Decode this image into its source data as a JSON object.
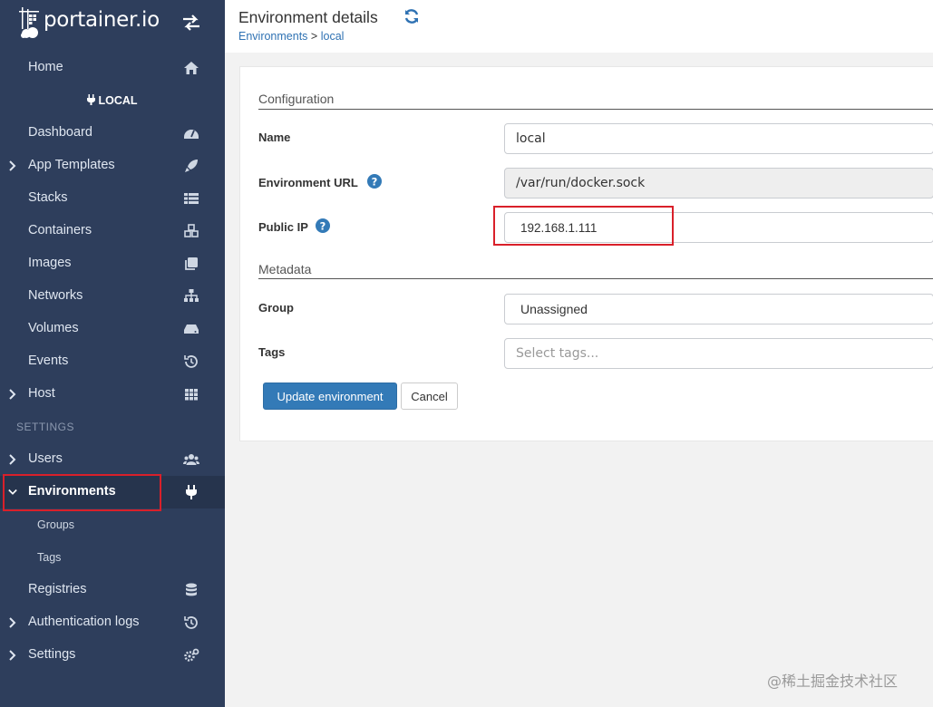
{
  "brand": {
    "name": "portainer.io"
  },
  "sidebar": {
    "home": "Home",
    "environment_badge": "LOCAL",
    "items": [
      {
        "label": "Dashboard",
        "icon": "dashboard-icon"
      },
      {
        "label": "App Templates",
        "icon": "rocket-icon",
        "expandable": true
      },
      {
        "label": "Stacks",
        "icon": "th-list-icon"
      },
      {
        "label": "Containers",
        "icon": "cubes-icon"
      },
      {
        "label": "Images",
        "icon": "clone-icon"
      },
      {
        "label": "Networks",
        "icon": "sitemap-icon"
      },
      {
        "label": "Volumes",
        "icon": "hdd-icon"
      },
      {
        "label": "Events",
        "icon": "history-icon"
      },
      {
        "label": "Host",
        "icon": "th-icon",
        "expandable": true
      }
    ],
    "settings_section": "SETTINGS",
    "settings_items": [
      {
        "label": "Users",
        "icon": "users-icon",
        "expandable": true
      },
      {
        "label": "Environments",
        "icon": "plug-icon",
        "expanded": true,
        "active": true
      },
      {
        "label": "Groups",
        "sub": true
      },
      {
        "label": "Tags",
        "sub": true
      },
      {
        "label": "Registries",
        "icon": "database-icon"
      },
      {
        "label": "Authentication logs",
        "icon": "history-icon",
        "expandable": true
      },
      {
        "label": "Settings",
        "icon": "cogs-icon",
        "expandable": true
      }
    ]
  },
  "header": {
    "title": "Environment details",
    "breadcrumb_parent": "Environments",
    "breadcrumb_separator": ">",
    "breadcrumb_current": "local"
  },
  "form": {
    "configuration_title": "Configuration",
    "name_label": "Name",
    "name_value": "local",
    "url_label": "Environment URL",
    "url_value": "/var/run/docker.sock",
    "public_ip_label": "Public IP",
    "public_ip_value": "192.168.1.111",
    "metadata_title": "Metadata",
    "group_label": "Group",
    "group_value": "Unassigned",
    "tags_label": "Tags",
    "tags_placeholder": "Select tags...",
    "update_button": "Update environment",
    "cancel_button": "Cancel"
  },
  "colors": {
    "sidebar_bg": "#2e3e5c",
    "primary": "#337ab7",
    "highlight": "#d9202a",
    "link": "#2f72b3"
  },
  "watermark": "@稀土掘金技术社区"
}
